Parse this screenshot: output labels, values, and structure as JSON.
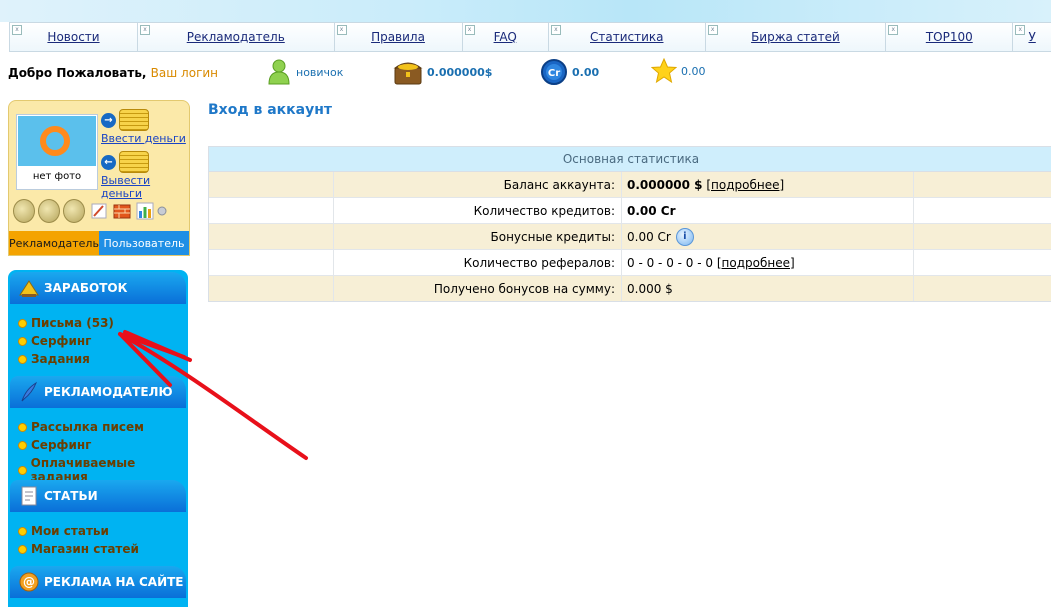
{
  "nav": {
    "items": [
      "Новости",
      "Рекламодатель",
      "Правила",
      "FAQ",
      "Статистика",
      "Биржа статей",
      "TOP100",
      "У"
    ]
  },
  "welcome": {
    "greeting": "Добро Пожаловать,",
    "login": "Ваш логин"
  },
  "status": {
    "rank": "новичок",
    "balance": "0.000000$",
    "credits": "0.00",
    "stars": "0.00"
  },
  "user_box": {
    "photo_caption": "нет фото",
    "deposit": "Ввести деньги",
    "withdraw": "Вывести деньги",
    "tab_advertiser": "Рекламодатель",
    "tab_user": "Пользователь"
  },
  "sidebar": {
    "sections": [
      {
        "title": "ЗАРАБОТОК",
        "items": [
          "Письма (53)",
          "Серфинг",
          "Задания"
        ]
      },
      {
        "title": "РЕКЛАМОДАТЕЛЮ",
        "items": [
          "Рассылка писем",
          "Серфинг",
          "Оплачиваемые задания"
        ]
      },
      {
        "title": "СТАТЬИ",
        "items": [
          "Мои статьи",
          "Магазин статей"
        ]
      },
      {
        "title": "РЕКЛАМА НА САЙТЕ",
        "items": []
      }
    ]
  },
  "main": {
    "title": "Вход в аккаунт",
    "stats_title": "Основная статистика",
    "rows": [
      {
        "label": "Баланс аккаунта:",
        "value": "0.000000 $",
        "more": "[подробнее]"
      },
      {
        "label": "Количество кредитов:",
        "value": "0.00 Cr"
      },
      {
        "label": "Бонусные кредиты:",
        "value": "0.00 Cr"
      },
      {
        "label": "Количество рефералов:",
        "value": "0 - 0 - 0 - 0 - 0",
        "more": "[подробнее]"
      },
      {
        "label": "Получено бонусов на сумму:",
        "value": "0.000 $"
      }
    ]
  },
  "colors": {
    "accent": "#1f78c8",
    "sidebar": "#00b3f2",
    "annotation": "#e8101a"
  }
}
